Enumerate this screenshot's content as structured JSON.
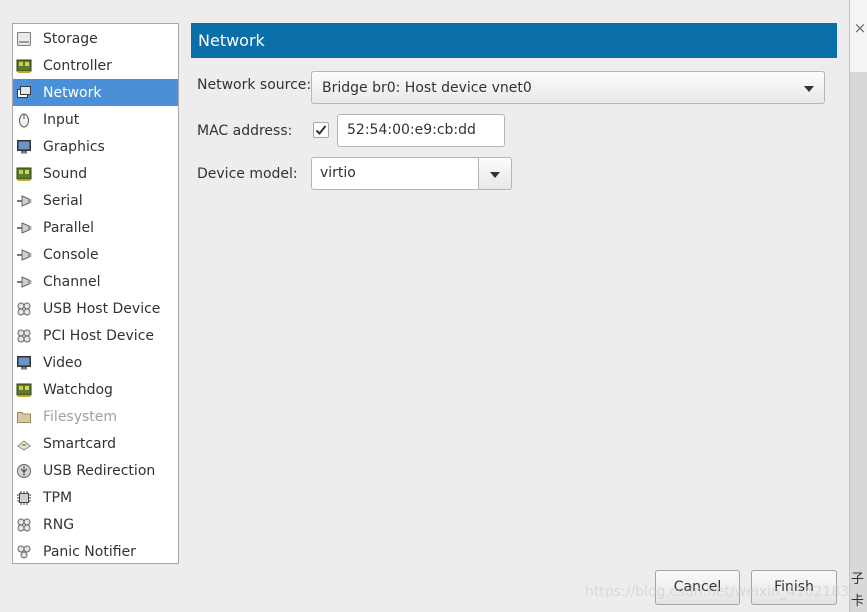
{
  "sidebar": {
    "items": [
      {
        "label": "Storage",
        "icon": "storage-icon"
      },
      {
        "label": "Controller",
        "icon": "controller-icon"
      },
      {
        "label": "Network",
        "icon": "network-icon"
      },
      {
        "label": "Input",
        "icon": "mouse-icon"
      },
      {
        "label": "Graphics",
        "icon": "monitor-icon"
      },
      {
        "label": "Sound",
        "icon": "sound-card-icon"
      },
      {
        "label": "Serial",
        "icon": "serial-plug-icon"
      },
      {
        "label": "Parallel",
        "icon": "parallel-plug-icon"
      },
      {
        "label": "Console",
        "icon": "console-plug-icon"
      },
      {
        "label": "Channel",
        "icon": "channel-plug-icon"
      },
      {
        "label": "USB Host Device",
        "icon": "usb-host-icon"
      },
      {
        "label": "PCI Host Device",
        "icon": "pci-host-icon"
      },
      {
        "label": "Video",
        "icon": "video-monitor-icon"
      },
      {
        "label": "Watchdog",
        "icon": "watchdog-card-icon"
      },
      {
        "label": "Filesystem",
        "icon": "folder-icon"
      },
      {
        "label": "Smartcard",
        "icon": "smartcard-icon"
      },
      {
        "label": "USB Redirection",
        "icon": "usb-redirection-icon"
      },
      {
        "label": "TPM",
        "icon": "tpm-chip-icon"
      },
      {
        "label": "RNG",
        "icon": "rng-icon"
      },
      {
        "label": "Panic Notifier",
        "icon": "panic-notifier-icon"
      }
    ],
    "selected": "Network",
    "disabled": [
      "Filesystem"
    ]
  },
  "main": {
    "title": "Network",
    "network_source_label": "Network source:",
    "network_source_value": "Bridge br0: Host device vnet0",
    "mac_label": "MAC address:",
    "mac_checked": true,
    "mac_value": "52:54:00:e9:cb:dd",
    "device_model_label": "Device model:",
    "device_model_value": "virtio"
  },
  "buttons": {
    "cancel": "Cancel",
    "finish": "Finish"
  },
  "background": {
    "close_glyph": "×",
    "cjk_1": "子",
    "cjk_2": "卡"
  },
  "watermark": "https://blog.csdn.net/weixin_41621839",
  "colors": {
    "header_bg": "#0b6fa7",
    "selected_bg": "#4a90d9"
  }
}
